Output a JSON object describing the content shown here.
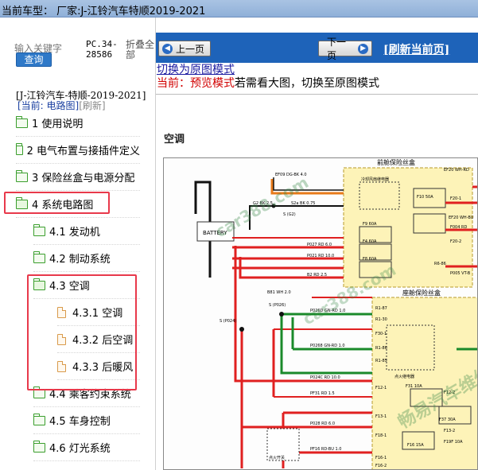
{
  "window": {
    "title": "当前车型： 厂家:J-江铃汽车特顺2019-2021"
  },
  "sidebar": {
    "search": {
      "placeholder": "输入关键字",
      "button_label": "查询"
    },
    "pc_code": "PC.34-28586",
    "collapse_label": "折叠全部",
    "tree_title": "[J-江铃汽车-特顺-2019-2021]",
    "current_prefix": "[当前: 电路图]",
    "refresh_label": "[刷新]",
    "tree": [
      {
        "label": "1 使用说明",
        "icon": "folder-icon",
        "level": 1
      },
      {
        "label": "2 电气布置与接插件定义",
        "icon": "folder-icon",
        "level": 1
      },
      {
        "label": "3 保险丝盒与电源分配",
        "icon": "folder-icon",
        "level": 1
      },
      {
        "label": "4 系统电路图",
        "icon": "folder-open-icon",
        "level": 1,
        "highlighted": true
      },
      {
        "label": "4.1 发动机",
        "icon": "folder-icon",
        "level": 2
      },
      {
        "label": "4.2 制动系统",
        "icon": "folder-icon",
        "level": 2
      },
      {
        "label": "4.3 空调",
        "icon": "folder-open-icon",
        "level": 2
      },
      {
        "label": "4.3.1 空调",
        "icon": "page-icon",
        "level": 3
      },
      {
        "label": "4.3.2 后空调",
        "icon": "page-icon",
        "level": 3
      },
      {
        "label": "4.3.3 后暖风",
        "icon": "page-icon",
        "level": 3
      },
      {
        "label": "4.4 乘客约束系统",
        "icon": "folder-icon",
        "level": 2
      },
      {
        "label": "4.5 车身控制",
        "icon": "folder-icon",
        "level": 2
      },
      {
        "label": "4.6 灯光系统",
        "icon": "folder-icon",
        "level": 2
      }
    ]
  },
  "viewer": {
    "prev_label": "上一页",
    "next_label": "下一页",
    "refresh_label": "[刷新当前页]",
    "switch_link": "切换为原图模式",
    "mode_prefix": "当前：预览模式",
    "mode_suffix": "若需看大图，切换至原图模式",
    "section_title": "空调",
    "diagram": {
      "front_fuse_box_label": "前舱保险丝盒",
      "cab_fuse_box_label": "座舱保险丝盒",
      "battery_label": "BATTERY",
      "wire_labels": [
        "EF09 DG-BK 4.0",
        "EF20 WH-RD",
        "F10 50A",
        "F20-1",
        "F004 RD",
        "G2 BK 2.5",
        "S2a BK 0.75",
        "S (G2)",
        "F9 60A",
        "EF20 WH-BU",
        "F4 60A",
        "F20-2",
        "F8 60A",
        "R6-86",
        "P005 VT-B",
        "P027 RD 6.0",
        "P021 RD 10.0",
        "B2 RD 2.5",
        "B81 WH 2.0",
        "P026D GN-RD 1.0",
        "P0268 GN-RD 1.0",
        "P024C RD 10.0",
        "PF31 RD 1.5",
        "F31 10A",
        "P028 RD 6.0",
        "PF16 RD-BU 1.0",
        "F37 30A",
        "F16 15A",
        "S (P026)",
        "S (P024)",
        "R1-87",
        "R1-30",
        "F30-1",
        "R1-86",
        "R1-85",
        "F12-1",
        "F13-1",
        "F18-1",
        "F16-1",
        "F12-2",
        "F13-2",
        "F16-2",
        "F19F 10A",
        "点火继电器",
        "冷却风扇继电器",
        "点火开关"
      ],
      "fuse_box_colors": {
        "wire_red": "#e02020",
        "wire_green": "#1a8a2a",
        "wire_black": "#111111",
        "wire_orange": "#e87a1a",
        "box_fill": "#fdf3b8",
        "box_border": "#b89a2a"
      },
      "watermarks": [
        "car388.com",
        "car388.com",
        "畅易汽车维修"
      ]
    }
  }
}
